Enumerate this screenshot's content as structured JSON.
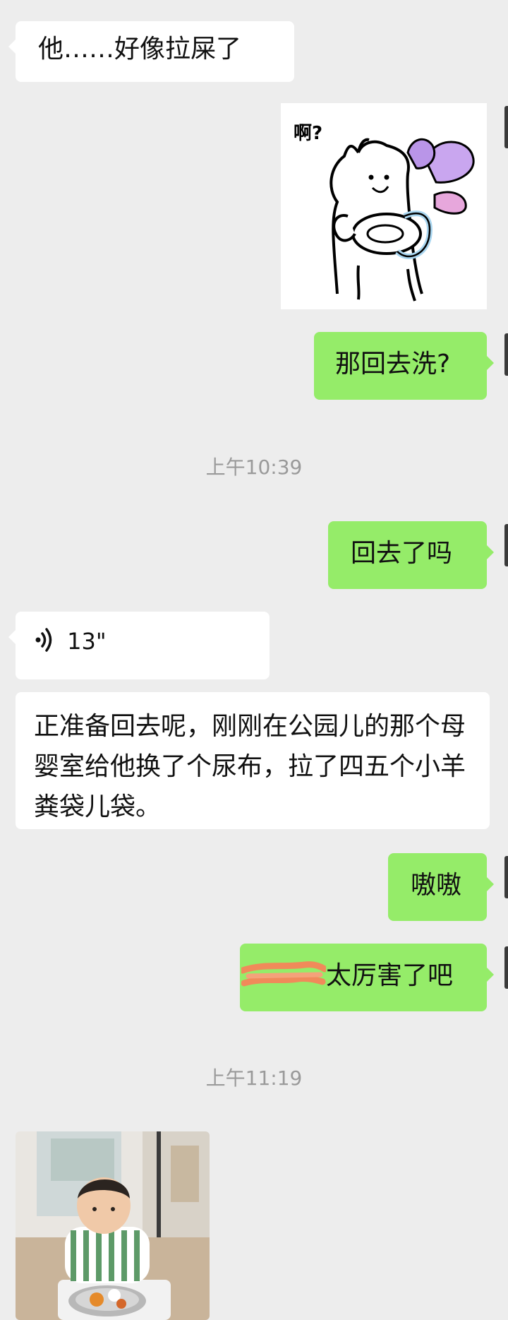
{
  "messages": {
    "m1_text": "他……好像拉屎了",
    "sticker_caption": "啊?",
    "m3_text": "那回去洗?",
    "ts1": "上午10:39",
    "m4_text": "回去了吗",
    "voice_duration": "13\"",
    "m6_text": "正准备回去呢，刚刚在公园儿的那个母婴室给他换了个尿布，拉了四五个小羊粪袋儿袋。",
    "m7_text": "嗷嗷",
    "m8_text": "太厉害了吧",
    "ts2": "上午11:19"
  },
  "colors": {
    "background": "#ededed",
    "incoming_bubble": "#ffffff",
    "outgoing_bubble": "#95ec69",
    "timestamp": "#9a9a9a",
    "redaction": "#f08a5a"
  },
  "icons": {
    "voice": "voice-wave-icon",
    "sticker": "cat-sticker",
    "photo": "baby-photo"
  }
}
